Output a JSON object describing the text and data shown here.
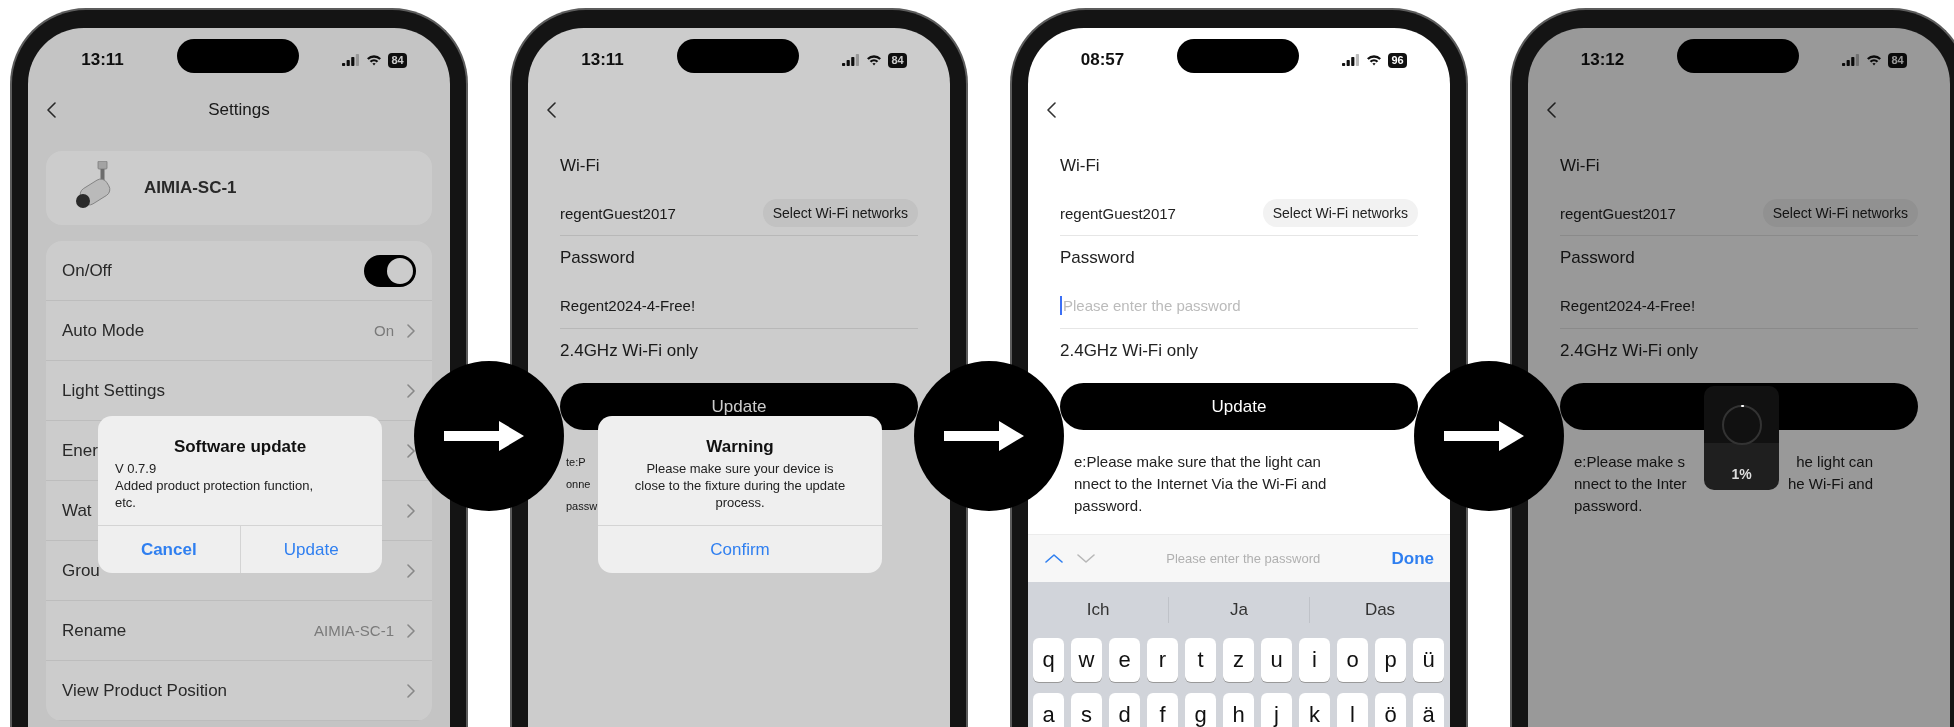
{
  "screens": [
    {
      "kind": "settings",
      "time": "13:11",
      "battery": "84",
      "title": "Settings",
      "device_name": "AIMIA-SC-1",
      "rows": [
        {
          "kind": "toggle",
          "label": "On/Off",
          "on": true
        },
        {
          "kind": "link",
          "label": "Auto Mode",
          "value": "On"
        },
        {
          "kind": "link",
          "label": "Light Settings"
        },
        {
          "kind": "link",
          "label": "Ener"
        },
        {
          "kind": "link",
          "label": "Wat"
        },
        {
          "kind": "link",
          "label": "Grou"
        },
        {
          "kind": "link",
          "label": "Rename",
          "value": "AIMIA-SC-1"
        },
        {
          "kind": "link",
          "label": "View Product Position"
        }
      ],
      "dialog": {
        "kind": "prompt",
        "title": "Software update",
        "body": "V 0.7.9\nAdded product protection function,\netc.",
        "buttons": [
          {
            "label": "Cancel",
            "preferred": true
          },
          {
            "label": "Update",
            "preferred": false
          }
        ]
      }
    },
    {
      "kind": "wifi",
      "time": "13:11",
      "battery": "84",
      "section_title": "Wi-Fi",
      "network": "regentGuest2017",
      "select_button": "Select Wi-Fi networks",
      "password_label": "Password",
      "password": {
        "value": "Regent2024-4-Free!"
      },
      "band_note": "2.4GHz Wi-Fi only",
      "update_button": "Update",
      "note_lines": [
        [
          "te:P"
        ],
        [
          "onne"
        ],
        [
          "passw"
        ]
      ],
      "dialog": {
        "kind": "alert",
        "title": "Warning",
        "body": "Please make sure your device is\nclose to the fixture during the update\nprocess.",
        "buttons": [
          {
            "label": "Confirm",
            "preferred": false
          }
        ]
      }
    },
    {
      "kind": "wifi",
      "time": "08:57",
      "battery": "96",
      "section_title": "Wi-Fi",
      "network": "regentGuest2017",
      "select_button": "Select Wi-Fi networks",
      "password_label": "Password",
      "password": {
        "placeholder": "Please enter the password",
        "focused": true
      },
      "band_note": "2.4GHz Wi-Fi only",
      "update_button": "Update",
      "note_lines": [
        [
          "e:Please make sure that the light can"
        ],
        [
          "nnect to the Internet Via the Wi-Fi and"
        ],
        [
          "password."
        ]
      ],
      "keyboard": {
        "prompt": "Please enter the password",
        "done": "Done",
        "suggestions": [
          "Ich",
          "Ja",
          "Das"
        ],
        "rows": [
          [
            "q",
            "w",
            "e",
            "r",
            "t",
            "z",
            "u",
            "i",
            "o",
            "p",
            "ü"
          ],
          [
            "a",
            "s",
            "d",
            "f",
            "g",
            "h",
            "j",
            "k",
            "l",
            "ö",
            "ä"
          ]
        ]
      }
    },
    {
      "kind": "wifi",
      "time": "13:12",
      "battery": "84",
      "section_title": "Wi-Fi",
      "network": "regentGuest2017",
      "select_button": "Select Wi-Fi networks",
      "password_label": "Password",
      "password": {
        "value": "Regent2024-4-Free!"
      },
      "band_note": "2.4GHz Wi-Fi only",
      "note_lines": [
        [
          "e:Please make s",
          "he light can"
        ],
        [
          "nnect to the Inter",
          "he Wi-Fi and"
        ],
        [
          "password."
        ]
      ],
      "progress": {
        "level": 0.01,
        "label": "1%"
      }
    }
  ]
}
